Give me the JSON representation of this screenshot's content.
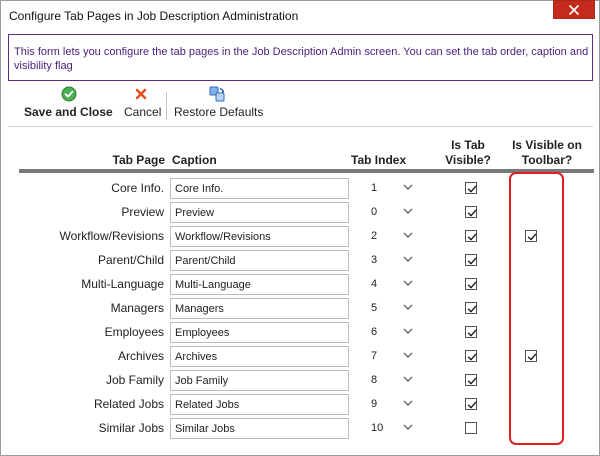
{
  "window": {
    "title": "Configure Tab Pages in Job Description Administration"
  },
  "info": {
    "text": "This form lets you configure the tab pages in the Job Description Admin screen. You can set the tab order, caption and visibility flag"
  },
  "toolbar": {
    "save_label": "Save and Close",
    "cancel_label": "Cancel",
    "restore_label": "Restore Defaults"
  },
  "headers": {
    "tab_page": "Tab Page",
    "caption": "Caption",
    "tab_index": "Tab Index",
    "is_tab_visible": "Is Tab Visible?",
    "is_visible_on_toolbar": "Is Visible on Toolbar?"
  },
  "colors": {
    "accent": "#5b2d87",
    "highlight": "#e02020",
    "close": "#c42b1c"
  },
  "rows": [
    {
      "name": "Core Info.",
      "caption": "Core Info.",
      "index": "1",
      "tab_visible": true,
      "on_toolbar": false
    },
    {
      "name": "Preview",
      "caption": "Preview",
      "index": "0",
      "tab_visible": true,
      "on_toolbar": false
    },
    {
      "name": "Workflow/Revisions",
      "caption": "Workflow/Revisions",
      "index": "2",
      "tab_visible": true,
      "on_toolbar": true
    },
    {
      "name": "Parent/Child",
      "caption": "Parent/Child",
      "index": "3",
      "tab_visible": true,
      "on_toolbar": false
    },
    {
      "name": "Multi-Language",
      "caption": "Multi-Language",
      "index": "4",
      "tab_visible": true,
      "on_toolbar": false
    },
    {
      "name": "Managers",
      "caption": "Managers",
      "index": "5",
      "tab_visible": true,
      "on_toolbar": false
    },
    {
      "name": "Employees",
      "caption": "Employees",
      "index": "6",
      "tab_visible": true,
      "on_toolbar": false
    },
    {
      "name": "Archives",
      "caption": "Archives",
      "index": "7",
      "tab_visible": true,
      "on_toolbar": true
    },
    {
      "name": "Job Family",
      "caption": "Job Family",
      "index": "8",
      "tab_visible": true,
      "on_toolbar": false
    },
    {
      "name": "Related Jobs",
      "caption": "Related Jobs",
      "index": "9",
      "tab_visible": true,
      "on_toolbar": false
    },
    {
      "name": "Similar Jobs",
      "caption": "Similar Jobs",
      "index": "10",
      "tab_visible": false,
      "on_toolbar": false
    }
  ]
}
